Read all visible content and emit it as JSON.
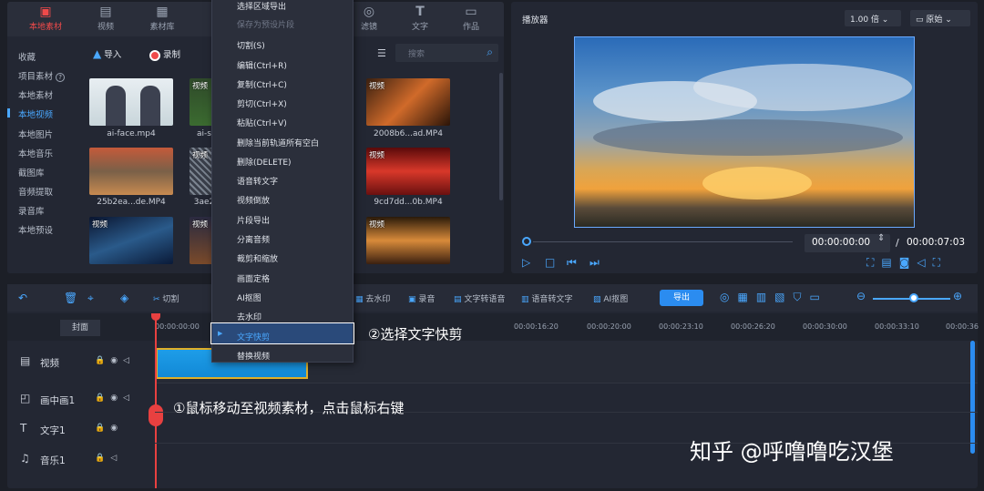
{
  "tabs": [
    {
      "label": "本地素材",
      "icon": "folder-icon"
    },
    {
      "label": "视频",
      "icon": "film-icon"
    },
    {
      "label": "素材库",
      "icon": "library-icon"
    },
    {
      "label": "滤镜",
      "icon": "filter-icon"
    },
    {
      "label": "文字",
      "icon": "text-icon"
    },
    {
      "label": "作品",
      "icon": "works-icon"
    }
  ],
  "sidebar": [
    "收藏",
    "项目素材",
    "本地素材",
    "本地视频",
    "本地图片",
    "本地音乐",
    "截图库",
    "音频提取",
    "录音库",
    "本地预设"
  ],
  "toolbar": {
    "import": "导入",
    "record": "录制",
    "search_placeholder": "搜索"
  },
  "thumbs": [
    {
      "label": "",
      "name": "ai-face.mp4"
    },
    {
      "label": "视频",
      "name": "ai-s"
    },
    {
      "label": "视频",
      "name": "2008b6...ad.MP4"
    },
    {
      "label": "",
      "name": "25b2ea...de.MP4"
    },
    {
      "label": "视频",
      "name": "3ae2"
    },
    {
      "label": "视频",
      "name": "9cd7dd...0b.MP4"
    },
    {
      "label": "视频",
      "name": ""
    },
    {
      "label": "视频",
      "name": ""
    },
    {
      "label": "视频",
      "name": ""
    }
  ],
  "menu": {
    "items": [
      "选择区域导出",
      "保存为预设片段",
      "切割(S)",
      "编辑(Ctrl+R)",
      "复制(Ctrl+C)",
      "剪切(Ctrl+X)",
      "粘贴(Ctrl+V)",
      "删除当前轨道所有空白",
      "删除(DELETE)",
      "语音转文字",
      "视频倒放",
      "片段导出",
      "分离音频",
      "裁剪和缩放",
      "画面定格",
      "AI抠图",
      "去水印",
      "文字快剪",
      "替换视频"
    ],
    "disabled": [
      1
    ],
    "selected": 17
  },
  "player": {
    "title": "播放器",
    "speed": "1.00 倍",
    "ratio": "原始",
    "current": "00:00:00:00",
    "sep": "/",
    "total": "00:00:07:03"
  },
  "timeline": {
    "tools": {
      "cut": "切割",
      "dewatermark": "去水印",
      "record": "录音",
      "text2speech": "文字转语音",
      "speech2text": "语音转文字",
      "matting": "AI抠图",
      "export": "导出"
    },
    "cover": "封面",
    "ticks": [
      "00:00:00:00",
      "00:00:16:20",
      "00:00:20:00",
      "00:00:23:10",
      "00:00:26:20",
      "00:00:30:00",
      "00:00:33:10",
      "00:00:36"
    ],
    "tracks": [
      {
        "name": "视频",
        "icon": "film-icon"
      },
      {
        "name": "画中画1",
        "icon": "pip-icon"
      },
      {
        "name": "文字1",
        "icon": "text-icon"
      },
      {
        "name": "音乐1",
        "icon": "music-icon"
      }
    ]
  },
  "annotations": {
    "step1": "①鼠标移动至视频素材，点击鼠标右键",
    "step2": "②选择文字快剪"
  },
  "watermark": "知乎 @呼噜噜吃汉堡"
}
